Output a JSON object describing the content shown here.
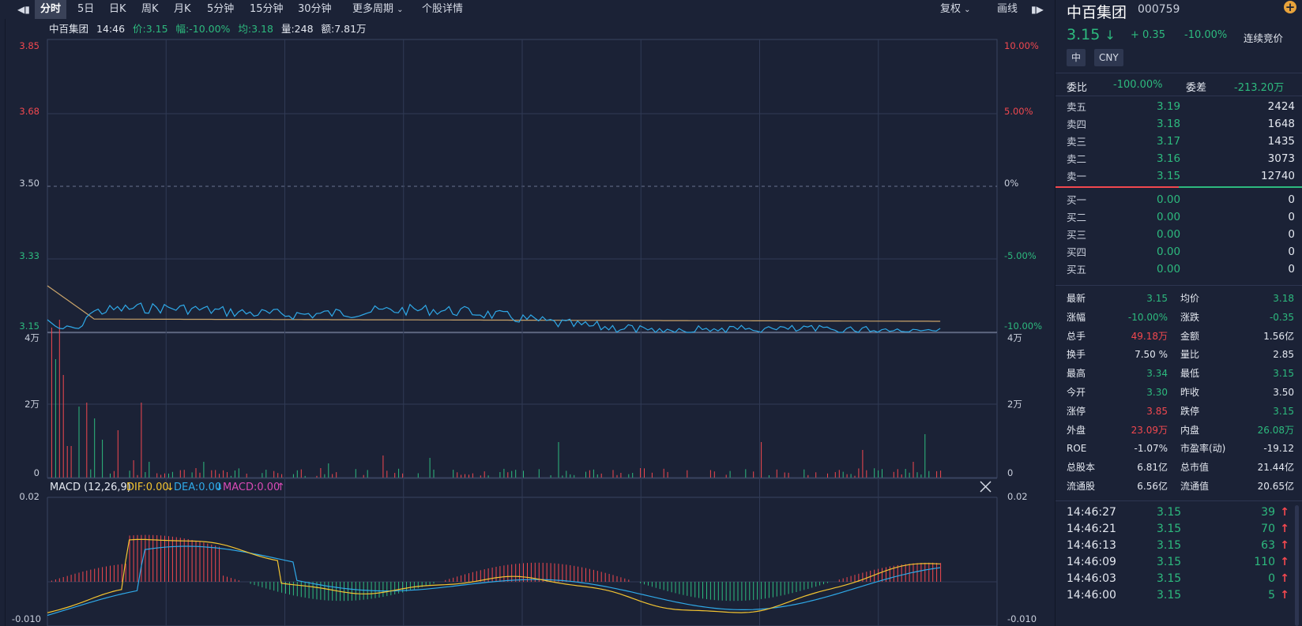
{
  "toolbar": {
    "tabs": [
      "分时",
      "5日",
      "日K",
      "周K",
      "月K",
      "5分钟",
      "15分钟",
      "30分钟",
      "更多周期",
      "个股详情"
    ],
    "active_tab": "分时",
    "fuquan": "复权",
    "draw": "画线"
  },
  "info": {
    "name": "中百集团",
    "time": "14:46",
    "price": "价:3.15",
    "change": "幅:-10.00%",
    "avg": "均:3.18",
    "volume": "量:248",
    "amount": "额:7.81万"
  },
  "chart": {
    "price_ticks": [
      "3.85",
      "3.68",
      "3.50",
      "3.33",
      "3.15"
    ],
    "pct_ticks": [
      "10.00%",
      "5.00%",
      "0%",
      "-5.00%",
      "-10.00%"
    ],
    "vol_ticks_left": [
      "4万",
      "2万",
      "0"
    ],
    "vol_ticks_right": [
      "4万",
      "2万",
      "0"
    ],
    "macd_label": "MACD (12,26,9)",
    "dif": "DIF:0.00",
    "dea": "DEA:0.00",
    "macd": "MACD:0.00",
    "macd_ticks": [
      "0.02",
      "-0.010"
    ],
    "colors": {
      "price": "#2fa9e8",
      "avg": "#c9a36a",
      "up": "#f2484f",
      "down": "#2dba7e",
      "dif": "#f3c431",
      "dea": "#2fa9e8",
      "macd": "#d84ab5"
    }
  },
  "panel": {
    "name": "中百集团",
    "code": "000759",
    "price": "3.15",
    "change": "+ 0.35",
    "pct": "-10.00%",
    "status": "连续竞价",
    "tags": [
      "中",
      "CNY"
    ],
    "weibi_label": "委比",
    "weibi": "-100.00%",
    "weicha_label": "委差",
    "weicha": "-213.20万",
    "asks": [
      {
        "label": "卖五",
        "price": "3.19",
        "vol": "2424"
      },
      {
        "label": "卖四",
        "price": "3.18",
        "vol": "1648"
      },
      {
        "label": "卖三",
        "price": "3.17",
        "vol": "1435"
      },
      {
        "label": "卖二",
        "price": "3.16",
        "vol": "3073"
      },
      {
        "label": "卖一",
        "price": "3.15",
        "vol": "12740"
      }
    ],
    "bids": [
      {
        "label": "买一",
        "price": "0.00",
        "vol": "0"
      },
      {
        "label": "买二",
        "price": "0.00",
        "vol": "0"
      },
      {
        "label": "买三",
        "price": "0.00",
        "vol": "0"
      },
      {
        "label": "买四",
        "price": "0.00",
        "vol": "0"
      },
      {
        "label": "买五",
        "price": "0.00",
        "vol": "0"
      }
    ],
    "stats": [
      {
        "l1": "最新",
        "v1": "3.15",
        "c1": "green",
        "l2": "均价",
        "v2": "3.18",
        "c2": "green"
      },
      {
        "l1": "涨幅",
        "v1": "-10.00%",
        "c1": "green",
        "l2": "涨跌",
        "v2": "-0.35",
        "c2": "green"
      },
      {
        "l1": "总手",
        "v1": "49.18万",
        "c1": "red",
        "l2": "金额",
        "v2": "1.56亿",
        "c2": "white"
      },
      {
        "l1": "换手",
        "v1": "7.50 %",
        "c1": "white",
        "l2": "量比",
        "v2": "2.85",
        "c2": "white"
      },
      {
        "l1": "最高",
        "v1": "3.34",
        "c1": "green",
        "l2": "最低",
        "v2": "3.15",
        "c2": "green"
      },
      {
        "l1": "今开",
        "v1": "3.30",
        "c1": "green",
        "l2": "昨收",
        "v2": "3.50",
        "c2": "white"
      },
      {
        "l1": "涨停",
        "v1": "3.85",
        "c1": "red",
        "l2": "跌停",
        "v2": "3.15",
        "c2": "green"
      },
      {
        "l1": "外盘",
        "v1": "23.09万",
        "c1": "red",
        "l2": "内盘",
        "v2": "26.08万",
        "c2": "green"
      },
      {
        "l1": "ROE",
        "v1": "-1.07%",
        "c1": "white",
        "l2": "市盈率(动)",
        "v2": "-19.12",
        "c2": "white"
      },
      {
        "l1": "总股本",
        "v1": "6.81亿",
        "c1": "white",
        "l2": "总市值",
        "v2": "21.44亿",
        "c2": "white"
      },
      {
        "l1": "流通股",
        "v1": "6.56亿",
        "c1": "white",
        "l2": "流通值",
        "v2": "20.65亿",
        "c2": "white"
      }
    ],
    "trades": [
      {
        "time": "14:46:27",
        "price": "3.15",
        "vol": "39"
      },
      {
        "time": "14:46:21",
        "price": "3.15",
        "vol": "70"
      },
      {
        "time": "14:46:13",
        "price": "3.15",
        "vol": "63"
      },
      {
        "time": "14:46:09",
        "price": "3.15",
        "vol": "110"
      },
      {
        "time": "14:46:03",
        "price": "3.15",
        "vol": "0"
      },
      {
        "time": "14:46:00",
        "price": "3.15",
        "vol": "5"
      }
    ]
  }
}
